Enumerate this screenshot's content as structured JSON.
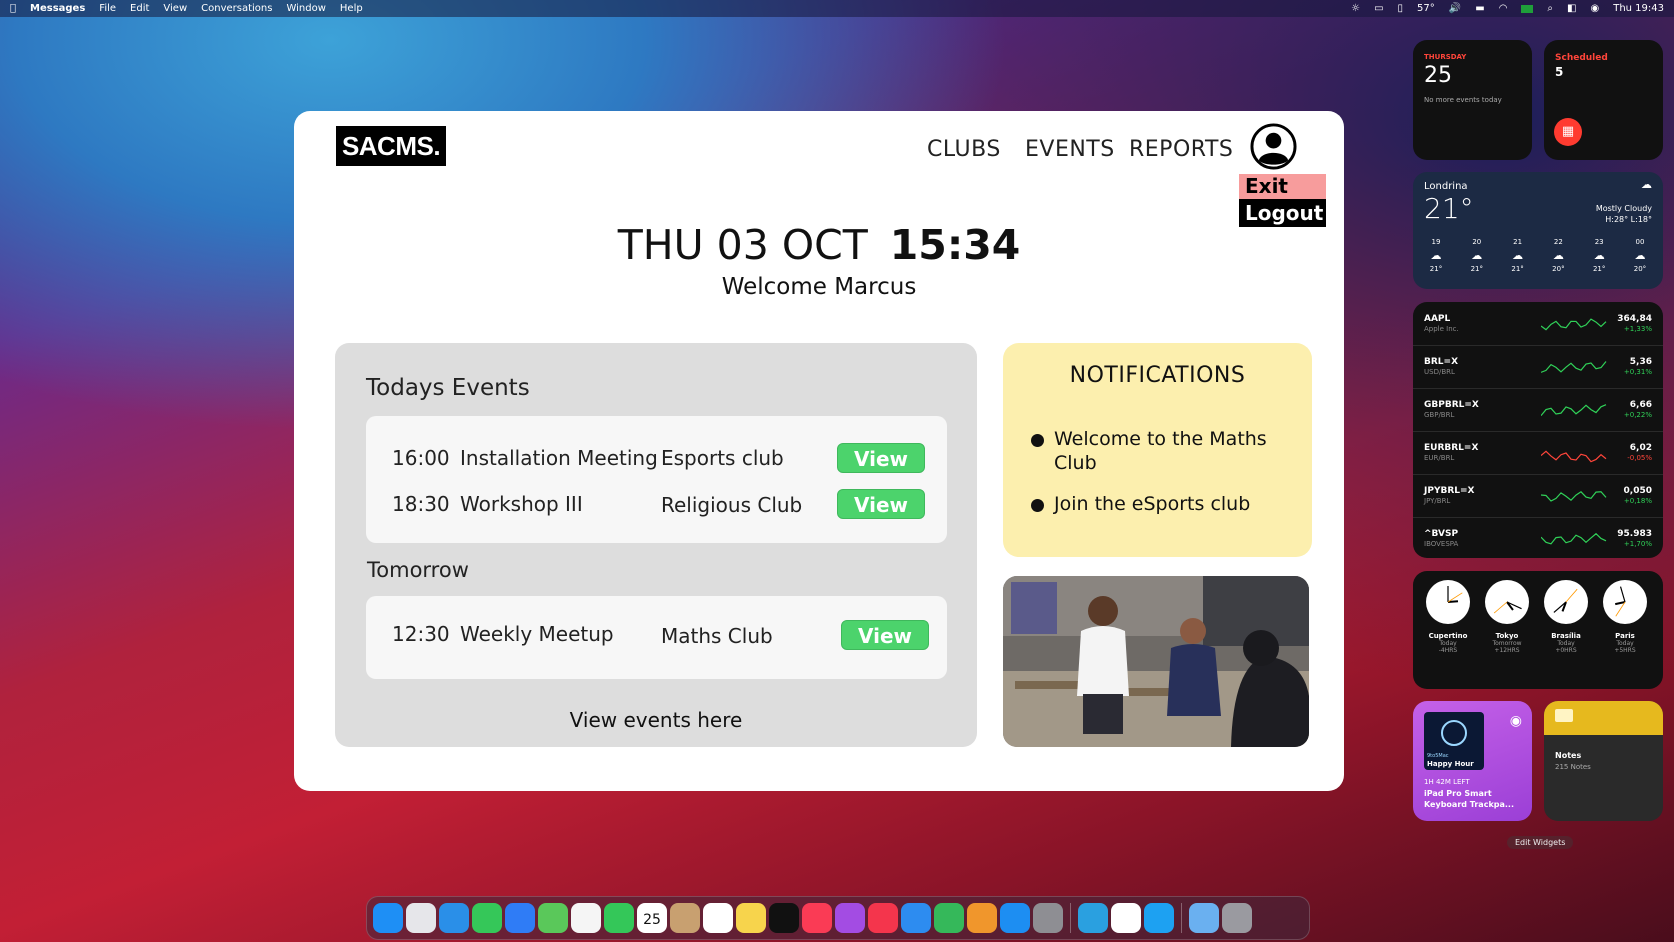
{
  "menubar": {
    "app": "Messages",
    "items": [
      "File",
      "Edit",
      "View",
      "Conversations",
      "Window",
      "Help"
    ],
    "temp": "57°",
    "clock": "Thu 19:43"
  },
  "app": {
    "logo": "SACMS.",
    "nav": [
      "CLUBS",
      "EVENTS",
      "REPORTS"
    ],
    "exit": "Exit",
    "logout": "Logout",
    "date": "THU 03 OCT",
    "time": "15:34",
    "welcome": "Welcome Marcus",
    "today_title": "Todays Events",
    "today": [
      {
        "time": "16:00",
        "name": "Installation Meeting",
        "club": "Esports club",
        "btn": "View"
      },
      {
        "time": "18:30",
        "name": "Workshop III",
        "club": "Religious Club",
        "btn": "View"
      }
    ],
    "tomorrow_title": "Tomorrow",
    "tomorrow": [
      {
        "time": "12:30",
        "name": "Weekly Meetup",
        "club": "Maths Club",
        "btn": "View"
      }
    ],
    "view_here": "View events here",
    "notif_title": "NOTIFICATIONS",
    "notifs": [
      "Welcome to the Maths Club",
      "Join the eSports club"
    ]
  },
  "widgets": {
    "calendar": {
      "day": "THURSDAY",
      "date": "25",
      "sub": "No more events today"
    },
    "scheduled": {
      "label": "Scheduled",
      "count": "5"
    },
    "weather": {
      "city": "Londrina",
      "temp": "21°",
      "cond": "Mostly Cloudy",
      "hl": "H:28° L:18°",
      "hours": [
        {
          "h": "19",
          "t": "21°"
        },
        {
          "h": "20",
          "t": "21°"
        },
        {
          "h": "21",
          "t": "21°"
        },
        {
          "h": "22",
          "t": "20°"
        },
        {
          "h": "23",
          "t": "21°"
        },
        {
          "h": "00",
          "t": "20°"
        }
      ]
    },
    "stocks": [
      {
        "s": "AAPL",
        "n": "Apple Inc.",
        "p": "364,84",
        "c": "+1,33%",
        "up": true
      },
      {
        "s": "BRL=X",
        "n": "USD/BRL",
        "p": "5,36",
        "c": "+0,31%",
        "up": true
      },
      {
        "s": "GBPBRL=X",
        "n": "GBP/BRL",
        "p": "6,66",
        "c": "+0,22%",
        "up": true
      },
      {
        "s": "EURBRL=X",
        "n": "EUR/BRL",
        "p": "6,02",
        "c": "-0,05%",
        "up": false
      },
      {
        "s": "JPYBRL=X",
        "n": "JPY/BRL",
        "p": "0,050",
        "c": "+0,18%",
        "up": true
      },
      {
        "s": "^BVSP",
        "n": "IBOVESPA",
        "p": "95.983",
        "c": "+1,70%",
        "up": true
      }
    ],
    "clocks": [
      {
        "c": "Cupertino",
        "d": "Today",
        "o": "-4HRS"
      },
      {
        "c": "Tokyo",
        "d": "Tomorrow",
        "o": "+12HRS"
      },
      {
        "c": "Brasília",
        "d": "Today",
        "o": "+0HRS"
      },
      {
        "c": "Paris",
        "d": "Today",
        "o": "+5HRS"
      }
    ],
    "podcast": {
      "brand": "9to5Mac",
      "show": "Happy Hour",
      "left": "1H 42M LEFT",
      "ep": "iPad Pro Smart Keyboard Trackpa..."
    },
    "notes": {
      "title": "Notes",
      "count": "215 Notes"
    },
    "edit": "Edit Widgets"
  },
  "colors": {
    "green": "#4cd36c",
    "notif": "#fcefae",
    "exit": "#f79c9c"
  }
}
